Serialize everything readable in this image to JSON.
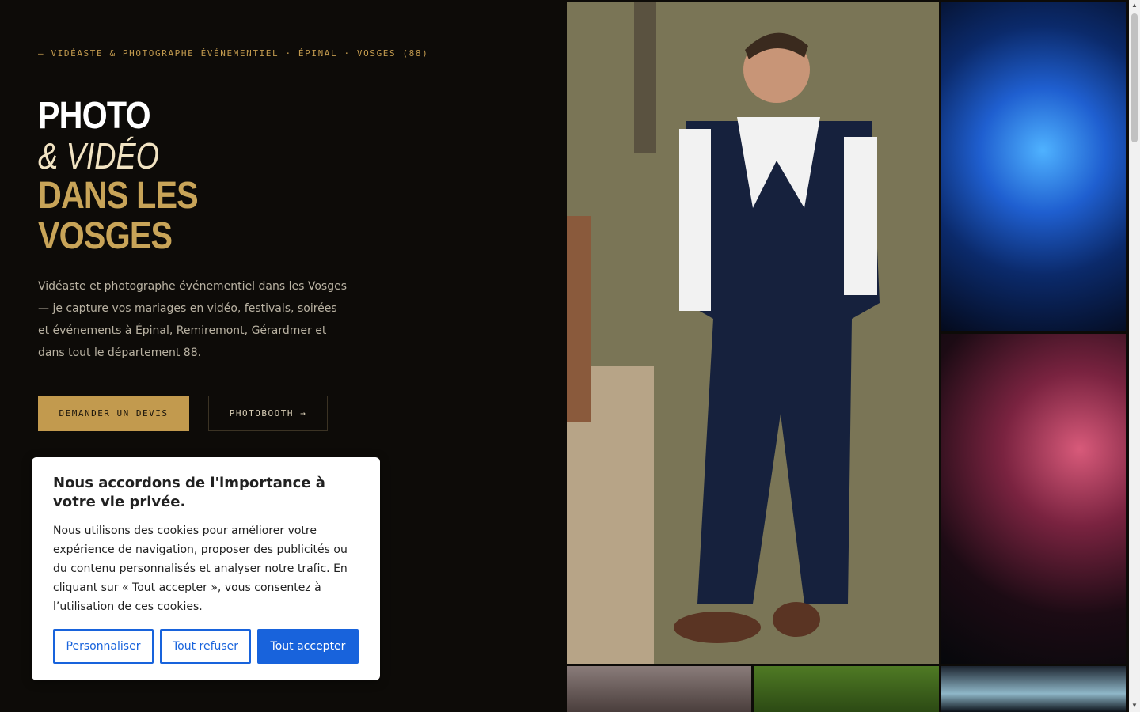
{
  "hero": {
    "kicker": "— VIDÉASTE & PHOTOGRAPHE ÉVÉNEMENTIEL · ÉPINAL · VOSGES (88)",
    "title_line1": "PHOTO",
    "title_line2": "& VIDÉO",
    "title_line3": "DANS LES",
    "title_line4": "VOSGES",
    "intro": "Vidéaste et photographe événementiel dans les Vosges — je capture vos mariages en vidéo, festivals, soirées et événements à Épinal, Remiremont, Gérardmer et dans tout le département 88.",
    "btn_quote": "DEMANDER UN DEVIS",
    "btn_photobooth": "PHOTOBOOTH →"
  },
  "colors": {
    "background": "#0d0b08",
    "gold": "#c29a4e",
    "cookie_accent": "#1863dc"
  },
  "cookie_banner": {
    "title": "Nous accordons de l'importance à votre vie privée.",
    "text": "Nous utilisons des cookies pour améliorer votre expérience de navigation, proposer des publicités ou du contenu personnalisés et analyser notre trafic. En cliquant sur « Tout accepter », vous consentez à l’utilisation de ces cookies.",
    "btn_customize": "Personnaliser",
    "btn_reject": "Tout refuser",
    "btn_accept": "Tout accepter"
  },
  "gallery": {
    "photos": [
      "portrait-man-suit",
      "led-costume-performer",
      "concert-smoke-red",
      "bottom-photo-1",
      "bottom-photo-2",
      "bottom-photo-3"
    ]
  },
  "scrollbar": {
    "up_icon": "▲",
    "down_icon": "▼"
  }
}
